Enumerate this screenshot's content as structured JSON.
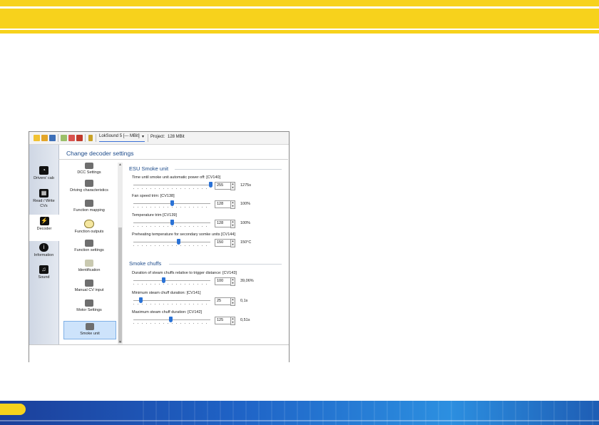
{
  "toolbar": {
    "decoder_combo": "LokSound 5 [--- MBit]",
    "project_label": "Project:",
    "project_value": "128 MBit"
  },
  "nav": [
    {
      "label": "Drivers' cab",
      "icon": "drivers-cab-icon"
    },
    {
      "label": "Read / Write CVs",
      "icon": "read-write-icon"
    },
    {
      "label": "Decoder",
      "icon": "decoder-icon"
    },
    {
      "label": "Information",
      "icon": "information-icon"
    },
    {
      "label": "Sound",
      "icon": "sound-icon"
    }
  ],
  "content_title": "Change decoder settings",
  "categories": [
    {
      "label": "DCC Settings",
      "icon": "dcc-icon"
    },
    {
      "label": "Driving characteristics",
      "icon": "sliders-icon"
    },
    {
      "label": "Function mapping",
      "icon": "function-mapping-icon"
    },
    {
      "label": "Function outputs",
      "icon": "bulb-icon"
    },
    {
      "label": "Function settings",
      "icon": "function-settings-icon"
    },
    {
      "label": "Identification",
      "icon": "id-card-icon"
    },
    {
      "label": "Manual CV input",
      "icon": "manual-cv-icon"
    },
    {
      "label": "Motor Settings",
      "icon": "motor-icon"
    },
    {
      "label": "Smoke unit",
      "icon": "smoke-icon"
    }
  ],
  "sections": {
    "smoke_unit": "ESU Smoke unit",
    "smoke_chuffs": "Smoke chuffs"
  },
  "settings": [
    {
      "label": "Time until smoke unit automatic power off: [CV140]",
      "value": "255",
      "unit": "1275s",
      "level": 1.0
    },
    {
      "label": "Fan speed trim: [CV138]",
      "value": "128",
      "unit": "100%",
      "level": 0.5
    },
    {
      "label": "Temperature trim [CV139]",
      "value": "128",
      "unit": "100%",
      "level": 0.5
    },
    {
      "label": "Preheating temperature for secondary somke units [CV144]",
      "value": "150",
      "unit": "150°C",
      "level": 0.59
    },
    {
      "label": "Duration of steam chuffs relative to trigger distance: [CV143]",
      "value": "100",
      "unit": "39,06%",
      "level": 0.39
    },
    {
      "label": "Minimum steam chuff duration: [CV141]",
      "value": "25",
      "unit": "0,1s",
      "level": 0.1
    },
    {
      "label": "Maximum steam chuff duration: [CV142]",
      "value": "125",
      "unit": "0,51s",
      "level": 0.49
    }
  ],
  "colors": {
    "accent_yellow": "#f7d21c",
    "brand_blue": "#1f63c6",
    "slider_knob": "#2a72d6"
  }
}
